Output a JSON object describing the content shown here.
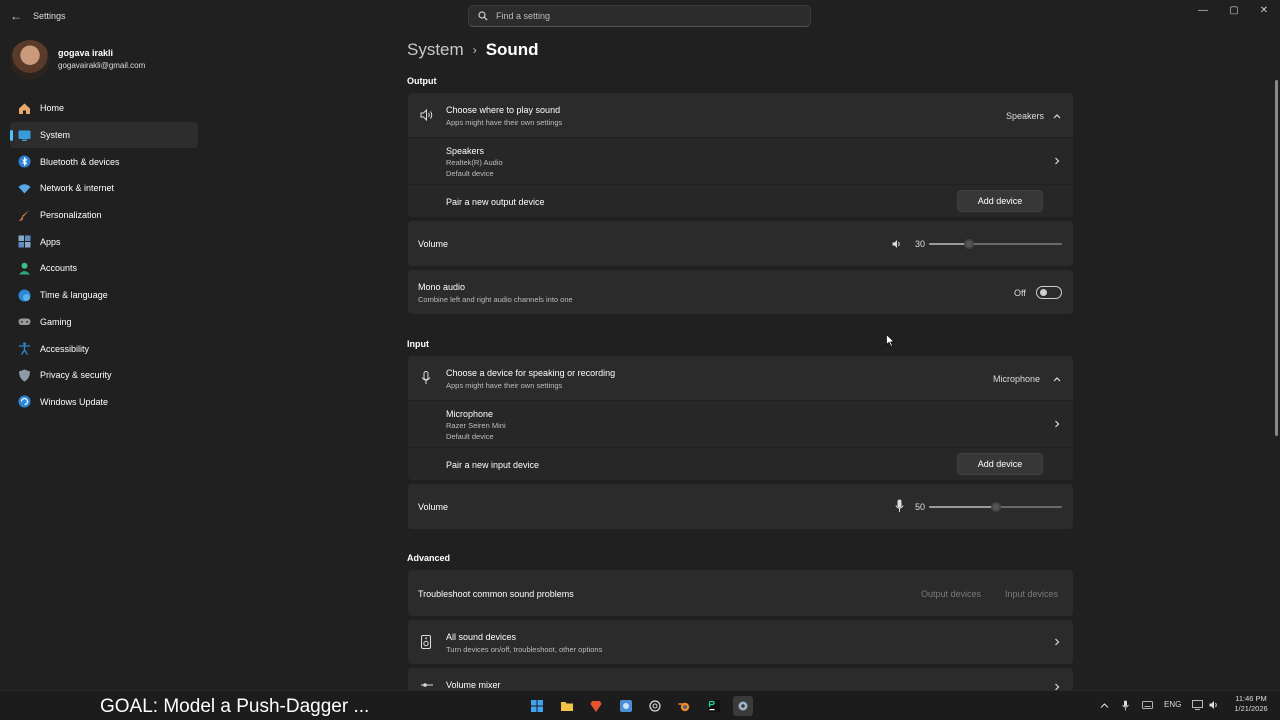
{
  "titlebar": {
    "app_title": "Settings",
    "search_placeholder": "Find a setting",
    "minimize_glyph": "—",
    "maximize_glyph": "▢",
    "close_glyph": "✕",
    "back_glyph": "←"
  },
  "profile": {
    "name": "gogava irakli",
    "email": "gogavairakli@gmail.com"
  },
  "sidebar": {
    "items": [
      {
        "label": "Home",
        "icon": "home-icon",
        "active": false
      },
      {
        "label": "System",
        "icon": "system-icon",
        "active": true
      },
      {
        "label": "Bluetooth & devices",
        "icon": "bluetooth-icon",
        "active": false
      },
      {
        "label": "Network & internet",
        "icon": "wifi-icon",
        "active": false
      },
      {
        "label": "Personalization",
        "icon": "brush-icon",
        "active": false
      },
      {
        "label": "Apps",
        "icon": "apps-icon",
        "active": false
      },
      {
        "label": "Accounts",
        "icon": "person-icon",
        "active": false
      },
      {
        "label": "Time & language",
        "icon": "globe-icon",
        "active": false
      },
      {
        "label": "Gaming",
        "icon": "gamepad-icon",
        "active": false
      },
      {
        "label": "Accessibility",
        "icon": "accessibility-icon",
        "active": false
      },
      {
        "label": "Privacy & security",
        "icon": "shield-icon",
        "active": false
      },
      {
        "label": "Windows Update",
        "icon": "update-icon",
        "active": false
      }
    ]
  },
  "breadcrumb": {
    "parent": "System",
    "separator": "›",
    "current": "Sound"
  },
  "output": {
    "section_title": "Output",
    "choose": {
      "title": "Choose where to play sound",
      "desc": "Apps might have their own settings",
      "selected": "Speakers"
    },
    "device": {
      "name": "Speakers",
      "driver": "Realtek(R) Audio",
      "status": "Default device"
    },
    "pair": {
      "label": "Pair a new output device",
      "button": "Add device"
    },
    "volume": {
      "label": "Volume",
      "value": "30",
      "level": 0.3
    },
    "mono": {
      "title": "Mono audio",
      "desc": "Combine left and right audio channels into one",
      "state": "Off"
    }
  },
  "input": {
    "section_title": "Input",
    "choose": {
      "title": "Choose a device for speaking or recording",
      "desc": "Apps might have their own settings",
      "selected": "Microphone"
    },
    "device": {
      "name": "Microphone",
      "driver": "Razer Seiren Mini",
      "status": "Default device"
    },
    "pair": {
      "label": "Pair a new input device",
      "button": "Add device"
    },
    "volume": {
      "label": "Volume",
      "value": "50",
      "level": 0.5
    }
  },
  "advanced": {
    "section_title": "Advanced",
    "troubleshoot": {
      "title": "Troubleshoot common sound problems",
      "link_output": "Output devices",
      "link_input": "Input devices"
    },
    "all_devices": {
      "title": "All sound devices",
      "desc": "Turn devices on/off, troubleshoot, other options"
    },
    "mixer": {
      "title": "Volume mixer"
    }
  },
  "taskbar": {
    "goal_text": "GOAL: Model a Push-Dagger ...",
    "language": "ENG",
    "time": "11:46 PM",
    "date": "1/21/2026"
  },
  "colors": {
    "accent": "#4cc2ff",
    "background": "#202020",
    "card": "#2b2b2b"
  }
}
